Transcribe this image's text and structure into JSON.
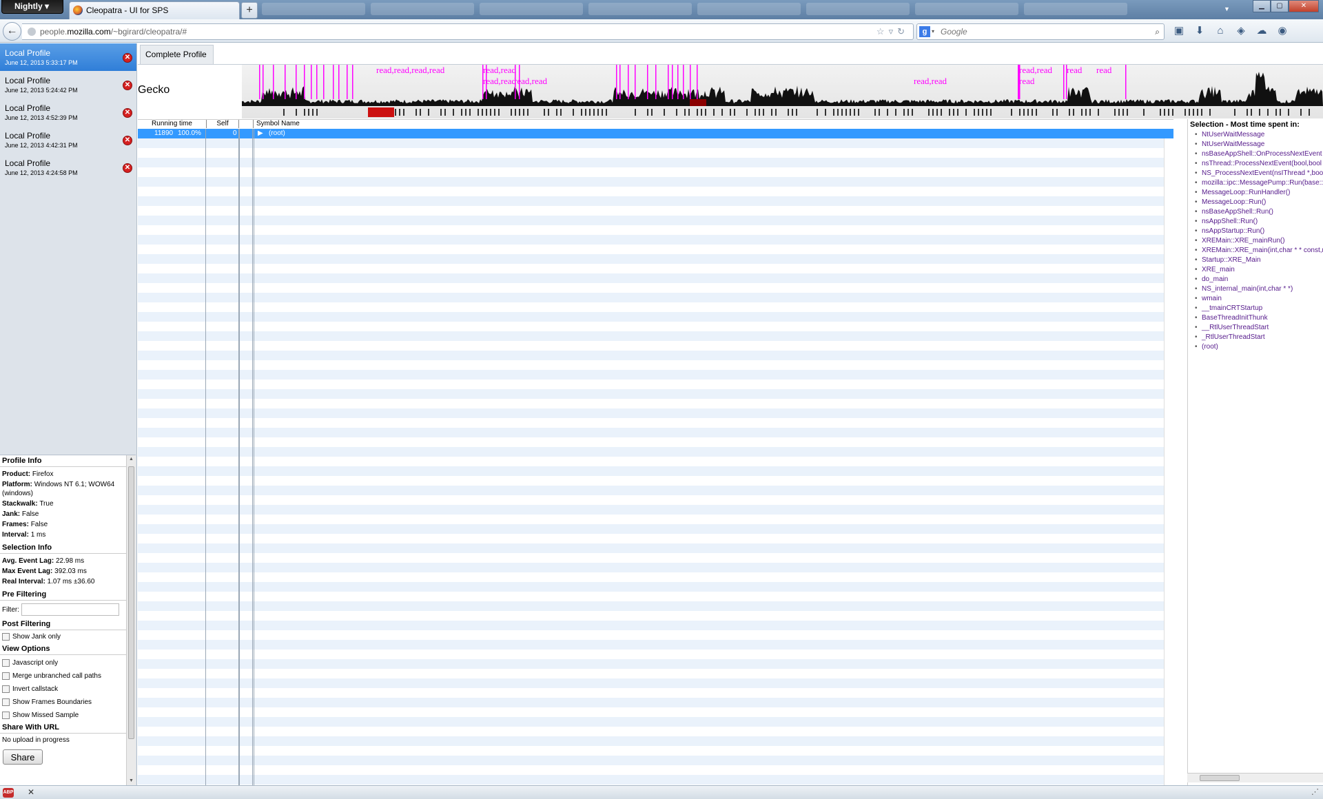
{
  "browser": {
    "menu_button": "Nightly",
    "tab_title": "Cleopatra - UI for SPS",
    "new_tab": "+",
    "url_prefix": "people.",
    "url_host": "mozilla.com",
    "url_path": "/~bgirard/cleopatra/#",
    "search_placeholder": "Google"
  },
  "profiles": [
    {
      "name": "Local Profile",
      "date": "June 12, 2013 5:33:17 PM",
      "selected": true
    },
    {
      "name": "Local Profile",
      "date": "June 12, 2013 5:24:42 PM"
    },
    {
      "name": "Local Profile",
      "date": "June 12, 2013 4:52:39 PM"
    },
    {
      "name": "Local Profile",
      "date": "June 12, 2013 4:42:31 PM"
    },
    {
      "name": "Local Profile",
      "date": "June 12, 2013 4:24:58 PM"
    }
  ],
  "profile_info": {
    "title": "Profile Info",
    "product_label": "Product:",
    "product": "Firefox",
    "platform_label": "Platform:",
    "platform": "Windows NT 6.1; WOW64 (windows)",
    "stackwalk_label": "Stackwalk:",
    "stackwalk": "True",
    "jank_label": "Jank:",
    "jank": "False",
    "frames_label": "Frames:",
    "frames": "False",
    "interval_label": "Interval:",
    "interval": "1 ms"
  },
  "selection_info": {
    "title": "Selection Info",
    "avg_label": "Avg. Event Lag:",
    "avg": "22.98 ms",
    "max_label": "Max Event Lag:",
    "max": "392.03 ms",
    "real_label": "Real Interval:",
    "real": "1.07 ms ±36.60"
  },
  "pre_filtering": {
    "title": "Pre Filtering",
    "filter_label": "Filter:",
    "filter_value": ""
  },
  "post_filtering": {
    "title": "Post Filtering",
    "show_jank": "Show Jank only"
  },
  "view_options": {
    "title": "View Options",
    "items": [
      "Javascript only",
      "Merge unbranched call paths",
      "Invert callstack",
      "Show Frames Boundaries",
      "Show Missed Sample"
    ]
  },
  "share": {
    "title": "Share With URL",
    "status": "No upload in progress",
    "button": "Share"
  },
  "main": {
    "tab": "Complete Profile",
    "thread_name": "Gecko",
    "marker_labels": [
      "read,read,read,read",
      "read,read",
      "read,read",
      "read,read",
      "read,read",
      "read,read",
      "read",
      "read",
      "read"
    ]
  },
  "tree": {
    "headers": {
      "running_time": "Running time",
      "self": "Self",
      "symbol": "Symbol Name"
    },
    "root": {
      "running_time": "11890",
      "percent": "100.0%",
      "self": "0",
      "symbol": "(root)"
    }
  },
  "selection_panel": {
    "title": "Selection - Most time spent in:",
    "stack": [
      "NtUserWaitMessage",
      "NtUserWaitMessage",
      "nsBaseAppShell::OnProcessNextEvent",
      "nsThread::ProcessNextEvent(bool,bool *)",
      "NS_ProcessNextEvent(nsIThread *,bool)",
      "mozilla::ipc::MessagePump::Run(base::MessagePump::Delegate *)",
      "MessageLoop::RunHandler()",
      "MessageLoop::Run()",
      "nsBaseAppShell::Run()",
      "nsAppShell::Run()",
      "nsAppStartup::Run()",
      "XREMain::XRE_mainRun()",
      "XREMain::XRE_main(int,char * * const,nsXREAppData const *)",
      "Startup::XRE_Main",
      "XRE_main",
      "do_main",
      "NS_internal_main(int,char * *)",
      "wmain",
      "__tmainCRTStartup",
      "BaseThreadInitThunk",
      "__RtlUserThreadStart",
      "_RtlUserThreadStart",
      "(root)"
    ]
  },
  "colors": {
    "selection_blue": "#3399ff",
    "marker_magenta": "#ff00ff",
    "close_red": "#d52020"
  }
}
